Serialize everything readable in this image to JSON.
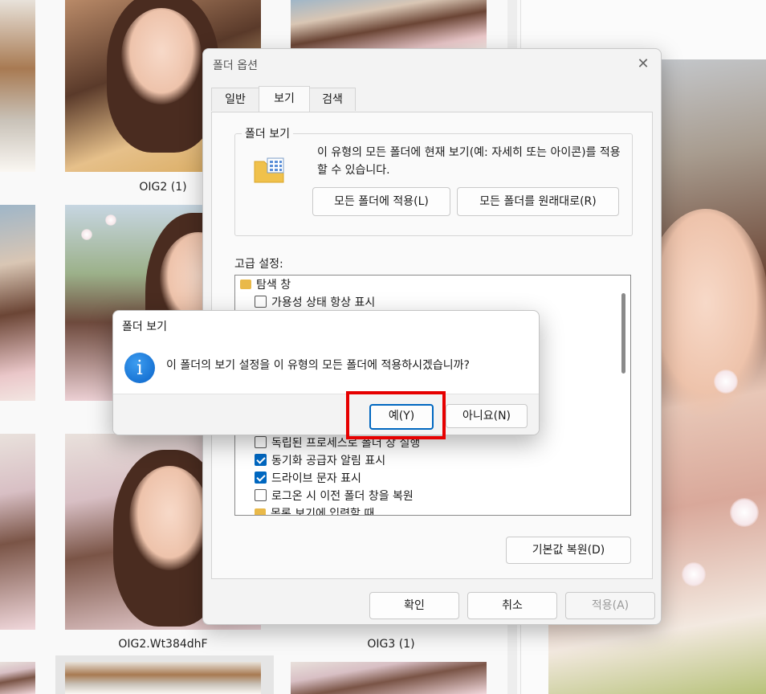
{
  "explorer": {
    "items": [
      {
        "label": ""
      },
      {
        "label": "OIG2 (1)"
      },
      {
        "label": ""
      },
      {
        "label": ""
      },
      {
        "label": ""
      },
      {
        "label": ""
      },
      {
        "label": "OIG2.Wt384dhF"
      },
      {
        "label": "OIG3 (1)"
      }
    ]
  },
  "folder_options": {
    "title": "폴더 옵션",
    "close_glyph": "✕",
    "tabs": [
      {
        "label": "일반",
        "active": false
      },
      {
        "label": "보기",
        "active": true
      },
      {
        "label": "검색",
        "active": false
      }
    ],
    "folder_view": {
      "group_title": "폴더 보기",
      "description": "이 유형의 모든 폴더에 현재 보기(예: 자세히 또는 아이콘)를 적용할 수 있습니다.",
      "apply_button": "모든 폴더에 적용(L)",
      "reset_button": "모든 폴더를 원래대로(R)"
    },
    "advanced": {
      "label": "고급 설정:",
      "tree": [
        {
          "type": "category",
          "label": "탐색 창",
          "icon": "folder-tree-icon"
        },
        {
          "type": "checkbox",
          "label": "가용성 상태 항상 표시",
          "checked": false
        },
        {
          "type": "checkbox",
          "label": "독립된 프로세스로 폴더 창 실행",
          "checked": false
        },
        {
          "type": "checkbox",
          "label": "동기화 공급자 알림 표시",
          "checked": true
        },
        {
          "type": "checkbox",
          "label": "드라이브 문자 표시",
          "checked": true
        },
        {
          "type": "checkbox",
          "label": "로그온 시 이전 폴더 창을 복원",
          "checked": false
        },
        {
          "type": "category",
          "label": "목록 보기에 입력할 때",
          "icon": "folder-icon"
        }
      ],
      "restore_defaults_button": "기본값 복원(D)"
    },
    "ok_button": "확인",
    "cancel_button": "취소",
    "apply_button": "적용(A)"
  },
  "confirm_dialog": {
    "title": "폴더 보기",
    "icon": "info-icon",
    "icon_glyph": "i",
    "message": "이 폴더의 보기 설정을 이 유형의 모든 폴더에 적용하시겠습니까?",
    "yes_button": "예(Y)",
    "no_button": "아니요(N)"
  },
  "colors": {
    "accent": "#0067c0",
    "highlight": "#e60000"
  }
}
